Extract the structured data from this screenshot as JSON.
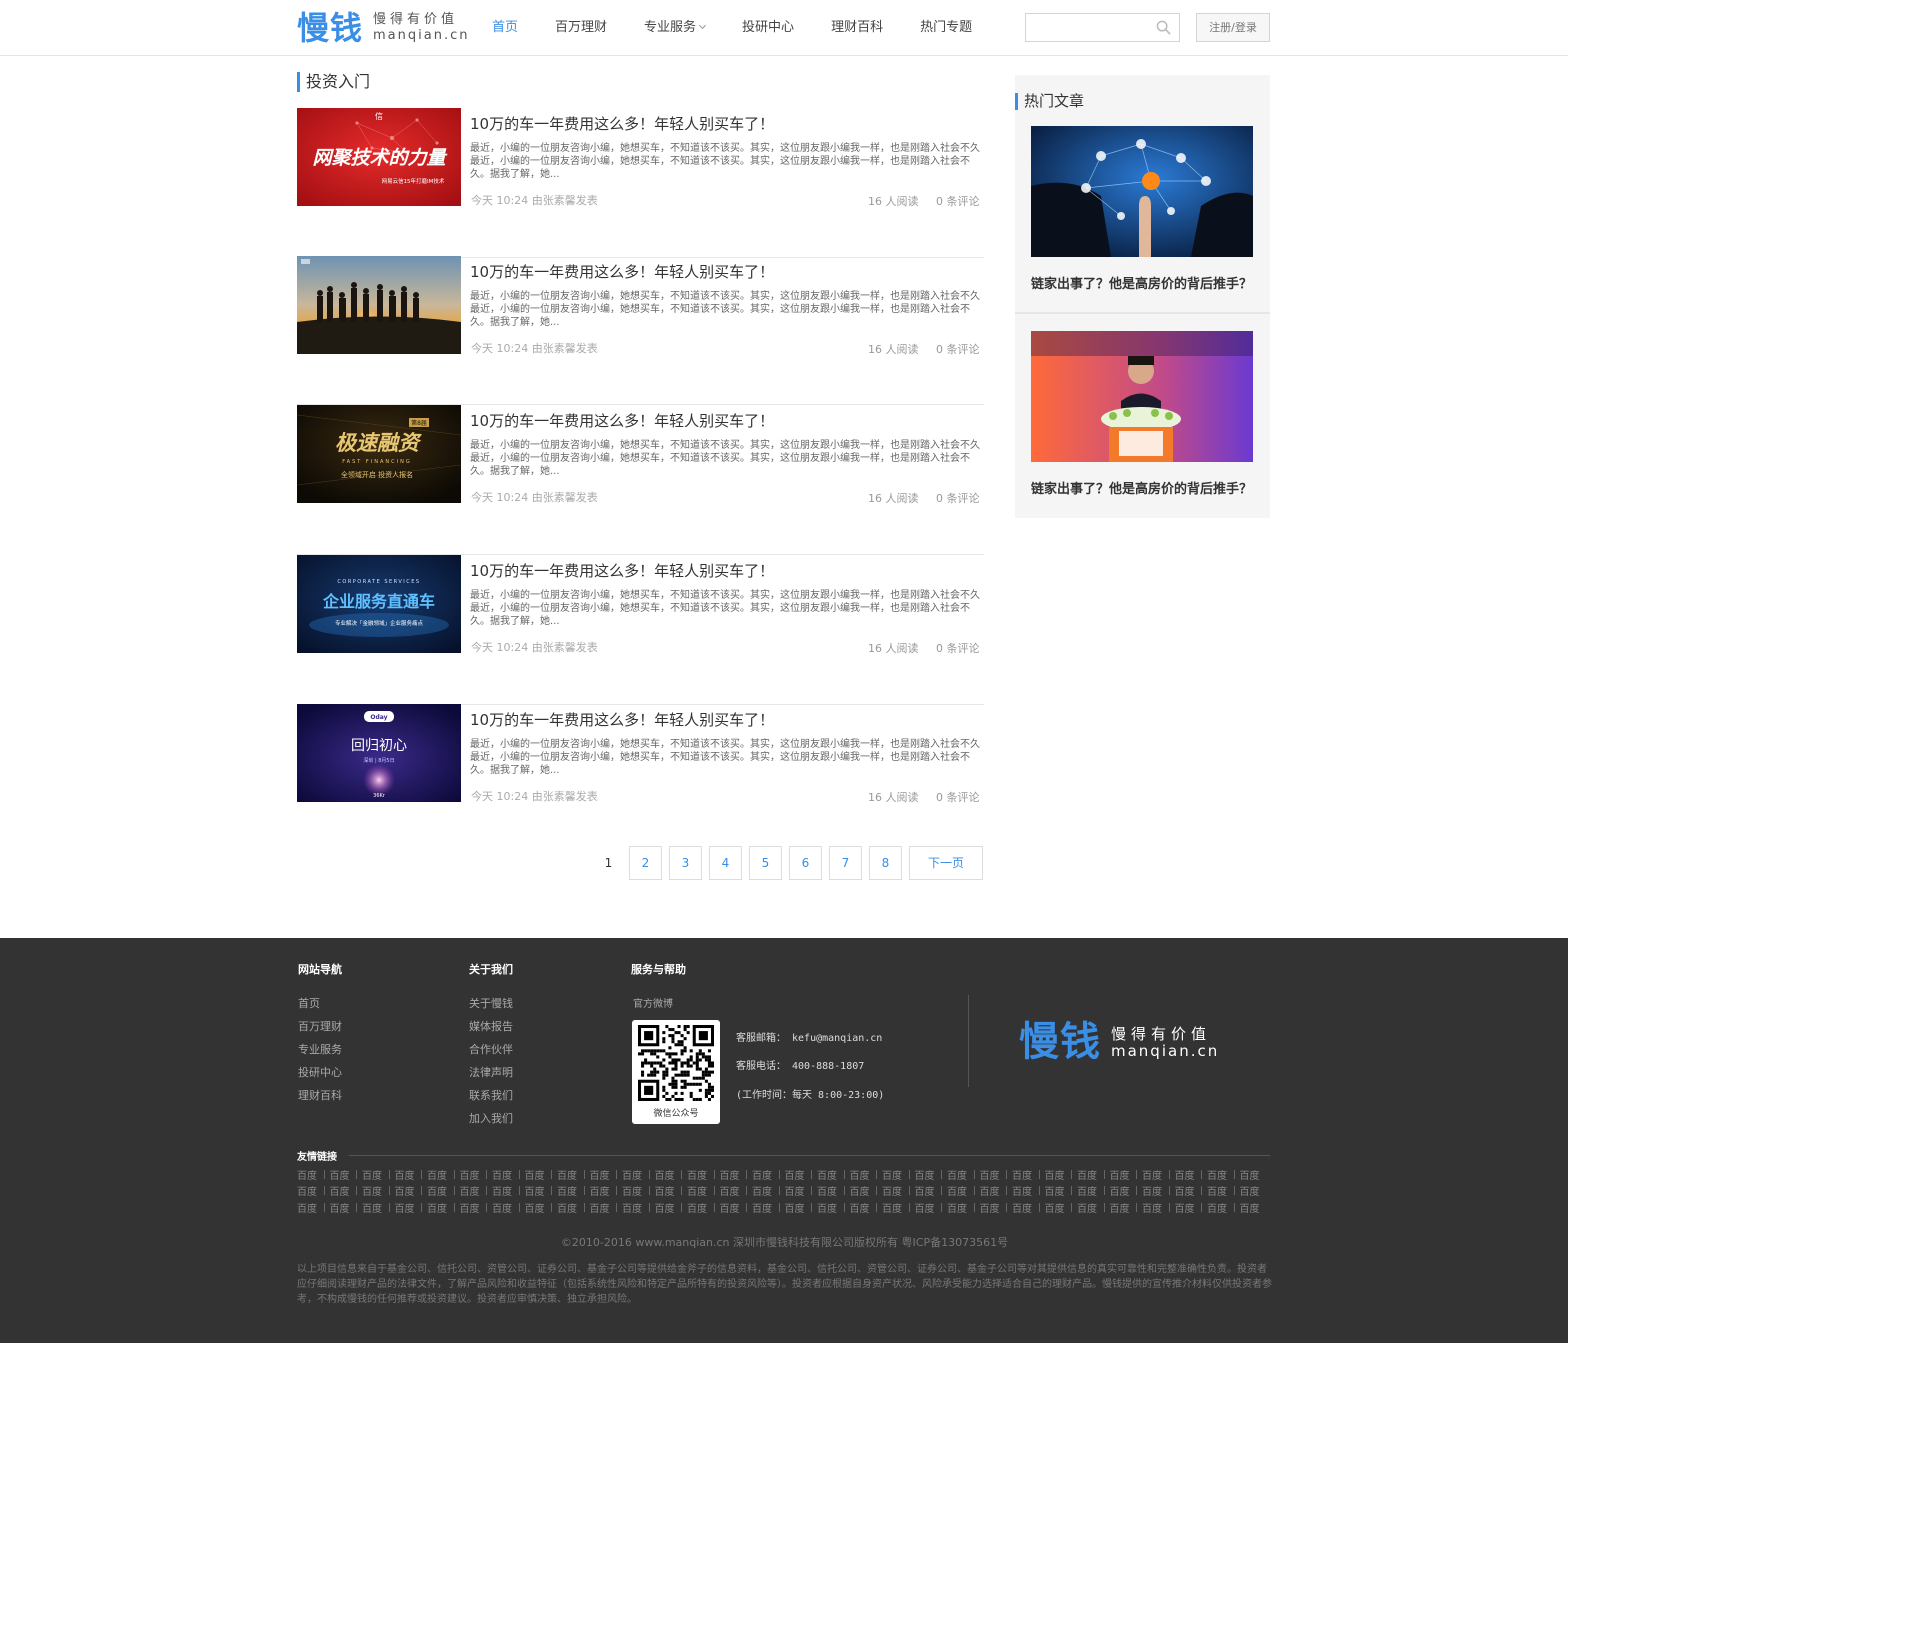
{
  "header": {
    "logo_cn": "慢钱",
    "logo_slogan": "慢得有价值",
    "logo_domain": "manqian.cn",
    "nav": [
      {
        "label": "首页",
        "active": true
      },
      {
        "label": "百万理财"
      },
      {
        "label": "专业服务",
        "dropdown": true
      },
      {
        "label": "投研中心"
      },
      {
        "label": "理财百科"
      },
      {
        "label": "热门专题"
      }
    ],
    "search_placeholder": "",
    "login_label": "注册/登录"
  },
  "main": {
    "section_title": "投资入门",
    "articles": [
      {
        "title": "10万的车一年费用这么多！年轻人别买车了！",
        "summary": "最近，小编的一位朋友咨询小编，她想买车，不知道该不该买。其实，这位朋友跟小编我一样，也是刚踏入社会不久最近，小编的一位朋友咨询小编，她想买车，不知道该不该买。其实，这位朋友跟小编我一样，也是刚踏入社会不久。据我了解，她...",
        "meta": "今天 10:24 由张素馨发表",
        "reads": "16 人阅读",
        "comments": "0 条评论",
        "thumb": "net-tech"
      },
      {
        "title": "10万的车一年费用这么多！年轻人别买车了！",
        "summary": "最近，小编的一位朋友咨询小编，她想买车，不知道该不该买。其实，这位朋友跟小编我一样，也是刚踏入社会不久最近，小编的一位朋友咨询小编，她想买车，不知道该不该买。其实，这位朋友跟小编我一样，也是刚踏入社会不久。据我了解，她...",
        "meta": "今天 10:24 由张素馨发表",
        "reads": "16 人阅读",
        "comments": "0 条评论",
        "thumb": "sunset-team"
      },
      {
        "title": "10万的车一年费用这么多！年轻人别买车了！",
        "summary": "最近，小编的一位朋友咨询小编，她想买车，不知道该不该买。其实，这位朋友跟小编我一样，也是刚踏入社会不久最近，小编的一位朋友咨询小编，她想买车，不知道该不该买。其实，这位朋友跟小编我一样，也是刚踏入社会不久。据我了解，她...",
        "meta": "今天 10:24 由张素馨发表",
        "reads": "16 人阅读",
        "comments": "0 条评论",
        "thumb": "fast-financing"
      },
      {
        "title": "10万的车一年费用这么多！年轻人别买车了！",
        "summary": "最近，小编的一位朋友咨询小编，她想买车，不知道该不该买。其实，这位朋友跟小编我一样，也是刚踏入社会不久最近，小编的一位朋友咨询小编，她想买车，不知道该不该买。其实，这位朋友跟小编我一样，也是刚踏入社会不久。据我了解，她...",
        "meta": "今天 10:24 由张素馨发表",
        "reads": "16 人阅读",
        "comments": "0 条评论",
        "thumb": "corporate-services"
      },
      {
        "title": "10万的车一年费用这么多！年轻人别买车了！",
        "summary": "最近，小编的一位朋友咨询小编，她想买车，不知道该不该买。其实，这位朋友跟小编我一样，也是刚踏入社会不久最近，小编的一位朋友咨询小编，她想买车，不知道该不该买。其实，这位朋友跟小编我一样，也是刚踏入社会不久。据我了解，她...",
        "meta": "今天 10:24 由张素馨发表",
        "reads": "16 人阅读",
        "comments": "0 条评论",
        "thumb": "oday"
      }
    ],
    "thumb_texts": {
      "net_tech_title": "网聚技术的力量",
      "net_tech_sub": "网易云信15年打磨IM技术",
      "net_tech_logo": "信",
      "fast_title": "极速融资",
      "fast_badge": "第8届",
      "fast_en": "FAST FINANCING",
      "fast_sub": "全领域开启 投资人报名",
      "corp_en": "CORPORATE SERVICES",
      "corp_title": "企业服务直通车",
      "corp_sub": "专业解决「金融领域」企业服务痛点",
      "oday_brand": "Oday",
      "oday_title": "回归初心",
      "oday_sub": "深圳 | 8月5日",
      "oday_kr": "36Kr"
    },
    "pagination": {
      "current": "1",
      "pages": [
        "2",
        "3",
        "4",
        "5",
        "6",
        "7",
        "8"
      ],
      "next_label": "下一页"
    }
  },
  "sidebar": {
    "title": "热门文章",
    "items": [
      {
        "title": "链家出事了？他是高房价的背后推手？",
        "image": "network-touch"
      },
      {
        "title": "链家出事了？他是高房价的背后推手？",
        "image": "speaker-podium"
      }
    ]
  },
  "footer": {
    "nav_title": "网站导航",
    "nav_links": [
      "首页",
      "百万理财",
      "专业服务",
      "投研中心",
      "理财百科"
    ],
    "about_title": "关于我们",
    "about_links": [
      "关于慢钱",
      "媒体报告",
      "合作伙伴",
      "法律声明",
      "联系我们",
      "加入我们"
    ],
    "service_title": "服务与帮助",
    "weibo_label": "官方微博",
    "qr_label": "微信公众号",
    "email": "客服邮箱： kefu@manqian.cn",
    "phone": "客服电话： 400-888-1807",
    "hours": "(工作时间：每天 8:00-23:00)",
    "logo_cn": "慢钱",
    "logo_slogan": "慢得有价值",
    "logo_domain": "manqian.cn",
    "friend_title": "友情链接",
    "friend_link_label": "百度",
    "copyright": "©2010-2016 www.manqian.cn 深圳市慢钱科技有限公司版权所有   粤ICP备13073561号",
    "disclaimer": "以上项目信息来自于基金公司、信托公司、资管公司、证券公司、基金子公司等提供给金斧子的信息资料，基金公司、信托公司、资管公司、证券公司、基金子公司等对其提供信息的真实可靠性和完整准确性负责。投资者应仔细阅读理财产品的法律文件，了解产品风险和收益特征（包括系统性风险和特定产品所特有的投资风险等）。投资者应根据自身资产状况、风险承受能力选择适合自己的理财产品。慢钱提供的宣传推介材料仅供投资者参考，不构成慢钱的任何推荐或投资建议。投资者应审慎决策、独立承担风险。"
  },
  "colors": {
    "accent": "#3a8ee6",
    "footer_bg": "#333333",
    "sidebar_bg": "#f5f5f5"
  }
}
